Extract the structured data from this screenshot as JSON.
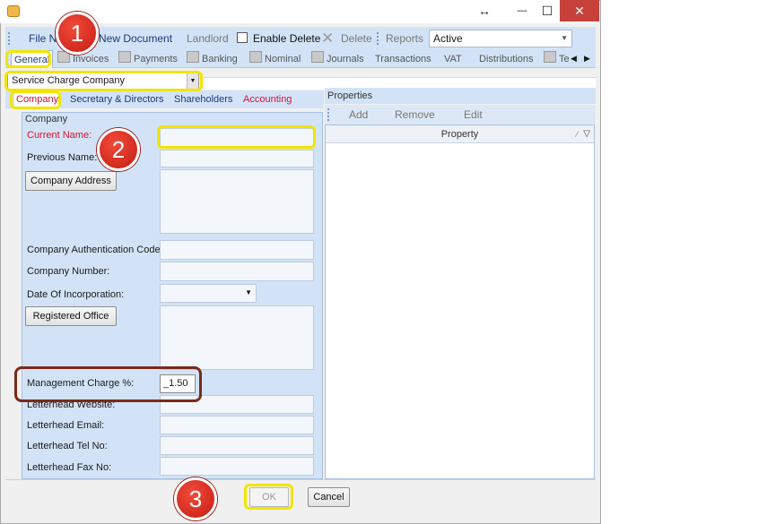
{
  "titlebar": {
    "restore_glyph": "↔",
    "min_glyph": "—",
    "max_glyph": "☐",
    "close_glyph": "✕"
  },
  "toolbar": {
    "file_label": "File N",
    "new_document": "New Document",
    "landlord": "Landlord",
    "enable_delete": "Enable Delete",
    "delete": "Delete",
    "reports": "Reports",
    "active_value": "Active"
  },
  "tabs": [
    "General",
    "Invoices",
    "Payments",
    "Banking",
    "Nominal",
    "Journals",
    "Transactions",
    "VAT",
    "Distributions",
    "Te"
  ],
  "type_combo": {
    "value": "Service Charge Company"
  },
  "subtabs": [
    "Company",
    "Secretary & Directors",
    "Shareholders",
    "Accounting"
  ],
  "company": {
    "legend": "Company",
    "current_name": "Current Name:",
    "previous_name": "Previous Name:",
    "company_address_btn": "Company Address",
    "auth_code": "Company Authentication Code:",
    "company_number": "Company Number:",
    "date_incorporation": "Date Of Incorporation:",
    "registered_office_btn": "Registered Office",
    "management_charge": "Management Charge %:",
    "management_charge_value": "_1.50",
    "letterhead_website": "Letterhead Website:",
    "letterhead_email": "Letterhead Email:",
    "letterhead_tel": "Letterhead Tel No:",
    "letterhead_fax": "Letterhead Fax No:"
  },
  "properties": {
    "title": "Properties",
    "add": "Add",
    "remove": "Remove",
    "edit": "Edit",
    "column": "Property"
  },
  "footer": {
    "ok": "OK",
    "cancel": "Cancel"
  },
  "markers": [
    "1",
    "2",
    "3"
  ],
  "colors": {
    "highlight": "#f2e500",
    "marker": "#d62a1e",
    "accent_red": "#d9102e",
    "toolbar_bg": "#d3e3f7"
  }
}
